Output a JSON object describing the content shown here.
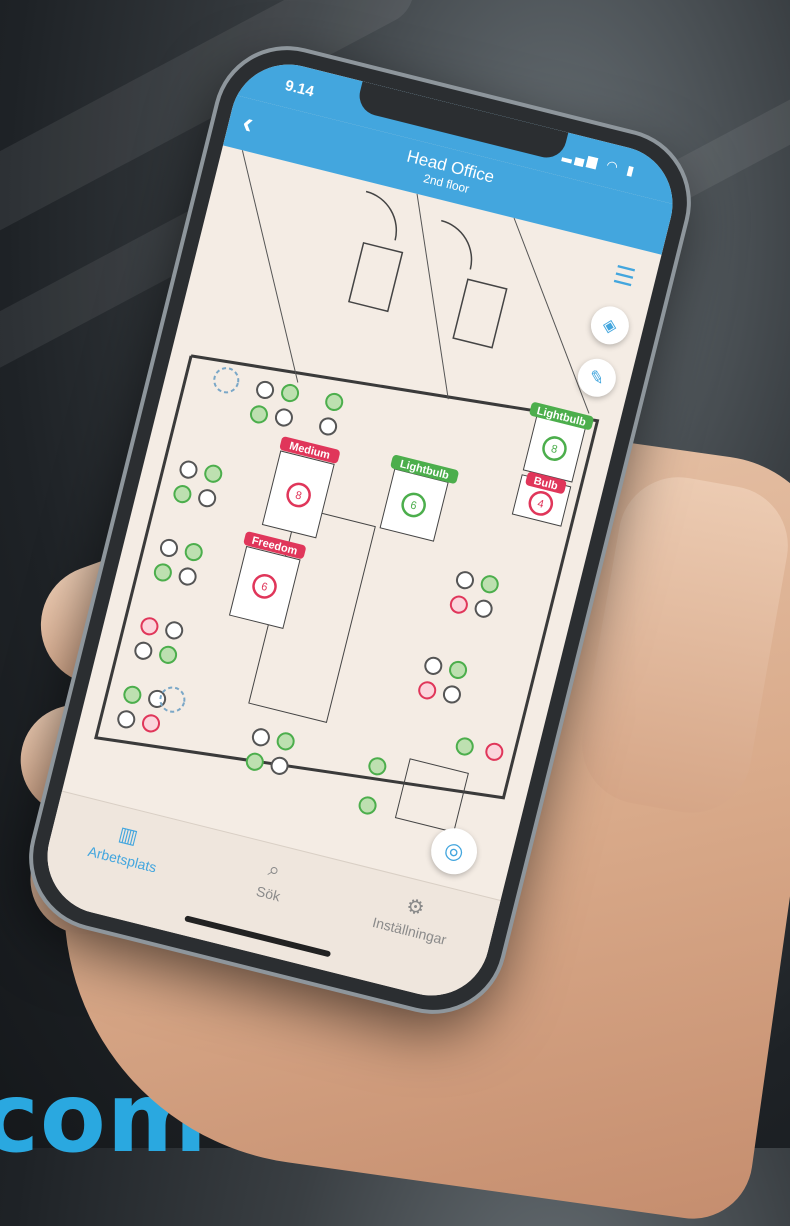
{
  "status_bar": {
    "time": "9.14",
    "icons": "signal-wifi-battery"
  },
  "nav": {
    "back_icon": "chevron-left-icon",
    "title": "Head Office",
    "subtitle": "2nd floor"
  },
  "floating_buttons": {
    "list_icon": "list-icon",
    "layers_icon": "layers-icon",
    "tools_icon": "wrench-icon",
    "locate_icon": "locate-icon"
  },
  "rooms": [
    {
      "name": "Medium",
      "capacity": "8",
      "color": "#e0365a"
    },
    {
      "name": "Freedom",
      "capacity": "6",
      "color": "#e0365a"
    },
    {
      "name": "Lightbulb",
      "capacity": "6",
      "color": "#4cae4c"
    },
    {
      "name": "Lightbulb",
      "capacity": "8",
      "color": "#4cae4c"
    },
    {
      "name": "Bulb",
      "capacity": "4",
      "color": "#e0365a"
    }
  ],
  "desk_status_colors": {
    "free": "#4cae4c",
    "booked": "#e0365a",
    "unavailable": "#555555"
  },
  "tabs": [
    {
      "label": "Arbetsplats",
      "icon": "building-icon",
      "active": true
    },
    {
      "label": "Sök",
      "icon": "search-icon",
      "active": false
    },
    {
      "label": "Inställningar",
      "icon": "gears-icon",
      "active": false
    }
  ],
  "background": {
    "domain_text": "com"
  },
  "colors": {
    "accent": "#43a6de",
    "map_bg": "#f4ece4"
  }
}
